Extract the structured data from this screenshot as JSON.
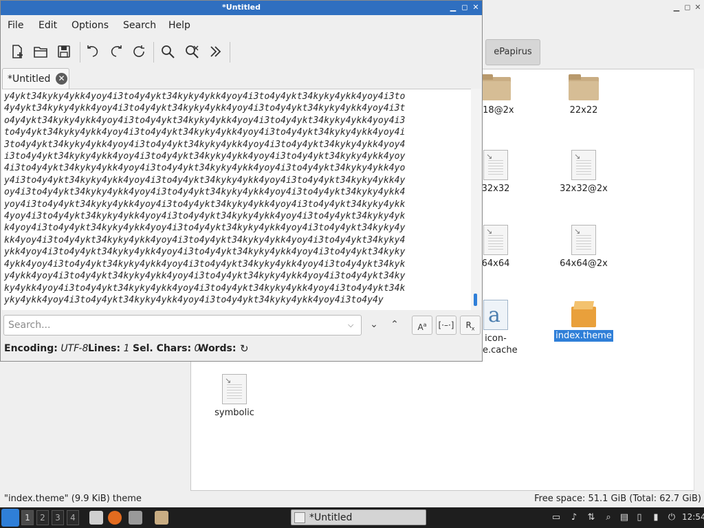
{
  "file_manager": {
    "tab_label": "ePapirus",
    "items": [
      {
        "label": "x18@2x",
        "type": "folder"
      },
      {
        "label": "22x22",
        "type": "folder"
      },
      {
        "label": "32x32",
        "type": "file"
      },
      {
        "label": "32x32@2x",
        "type": "file"
      },
      {
        "label": "64x64",
        "type": "file"
      },
      {
        "label": "64x64@2x",
        "type": "file"
      },
      {
        "label": "icon-",
        "label2": "me.cache",
        "type": "cache"
      },
      {
        "label": "index.theme",
        "type": "theme",
        "selected": true
      },
      {
        "label": "symbolic",
        "type": "file"
      }
    ],
    "status_left": "\"index.theme\" (9.9 KiB) theme",
    "status_right": "Free space: 51.1 GiB (Total: 62.7 GiB)"
  },
  "editor": {
    "title": "*Untitled",
    "menu": [
      "File",
      "Edit",
      "Options",
      "Search",
      "Help"
    ],
    "tab_label": "*Untitled",
    "text_lines": [
      "y4ykt34kyky4ykk4yoy4i3to4y4ykt34kyky4ykk4yoy4i3to4y4ykt34kyky4ykk4yoy4i3to",
      "4y4ykt34kyky4ykk4yoy4i3to4y4ykt34kyky4ykk4yoy4i3to4y4ykt34kyky4ykk4yoy4i3t",
      "o4y4ykt34kyky4ykk4yoy4i3to4y4ykt34kyky4ykk4yoy4i3to4y4ykt34kyky4ykk4yoy4i3",
      "to4y4ykt34kyky4ykk4yoy4i3to4y4ykt34kyky4ykk4yoy4i3to4y4ykt34kyky4ykk4yoy4i",
      "3to4y4ykt34kyky4ykk4yoy4i3to4y4ykt34kyky4ykk4yoy4i3to4y4ykt34kyky4ykk4yoy4",
      "i3to4y4ykt34kyky4ykk4yoy4i3to4y4ykt34kyky4ykk4yoy4i3to4y4ykt34kyky4ykk4yoy",
      "4i3to4y4ykt34kyky4ykk4yoy4i3to4y4ykt34kyky4ykk4yoy4i3to4y4ykt34kyky4ykk4yo",
      "y4i3to4y4ykt34kyky4ykk4yoy4i3to4y4ykt34kyky4ykk4yoy4i3to4y4ykt34kyky4ykk4y",
      "oy4i3to4y4ykt34kyky4ykk4yoy4i3to4y4ykt34kyky4ykk4yoy4i3to4y4ykt34kyky4ykk4",
      "yoy4i3to4y4ykt34kyky4ykk4yoy4i3to4y4ykt34kyky4ykk4yoy4i3to4y4ykt34kyky4ykk",
      "4yoy4i3to4y4ykt34kyky4ykk4yoy4i3to4y4ykt34kyky4ykk4yoy4i3to4y4ykt34kyky4yk",
      "k4yoy4i3to4y4ykt34kyky4ykk4yoy4i3to4y4ykt34kyky4ykk4yoy4i3to4y4ykt34kyky4y",
      "kk4yoy4i3to4y4ykt34kyky4ykk4yoy4i3to4y4ykt34kyky4ykk4yoy4i3to4y4ykt34kyky4",
      "ykk4yoy4i3to4y4ykt34kyky4ykk4yoy4i3to4y4ykt34kyky4ykk4yoy4i3to4y4ykt34kyky",
      "4ykk4yoy4i3to4y4ykt34kyky4ykk4yoy4i3to4y4ykt34kyky4ykk4yoy4i3to4y4ykt34kyk",
      "y4ykk4yoy4i3to4y4ykt34kyky4ykk4yoy4i3to4y4ykt34kyky4ykk4yoy4i3to4y4ykt34ky",
      "ky4ykk4yoy4i3to4y4ykt34kyky4ykk4yoy4i3to4y4ykt34kyky4ykk4yoy4i3to4y4ykt34k",
      "yky4ykk4yoy4i3to4y4ykt34kyky4ykk4yoy4i3to4y4ykt34kyky4ykk4yoy4i3to4y4y"
    ],
    "search": {
      "placeholder": "Search...",
      "value": ""
    },
    "status": {
      "encoding_label": "Encoding:",
      "encoding_value": "UTF-8",
      "lines_label": "Lines:",
      "lines_value": "1",
      "sel_label": "Sel. Chars:",
      "sel_value": "0",
      "words_label": "Words:"
    }
  },
  "taskbar": {
    "workspaces": [
      "1",
      "2",
      "3",
      "4"
    ],
    "task_label": "*Untitled",
    "clock": "12:54"
  },
  "colors": {
    "accent": "#2f7fd8",
    "titlebar": "#2f6fc0",
    "selection": "#2f7fd8"
  }
}
